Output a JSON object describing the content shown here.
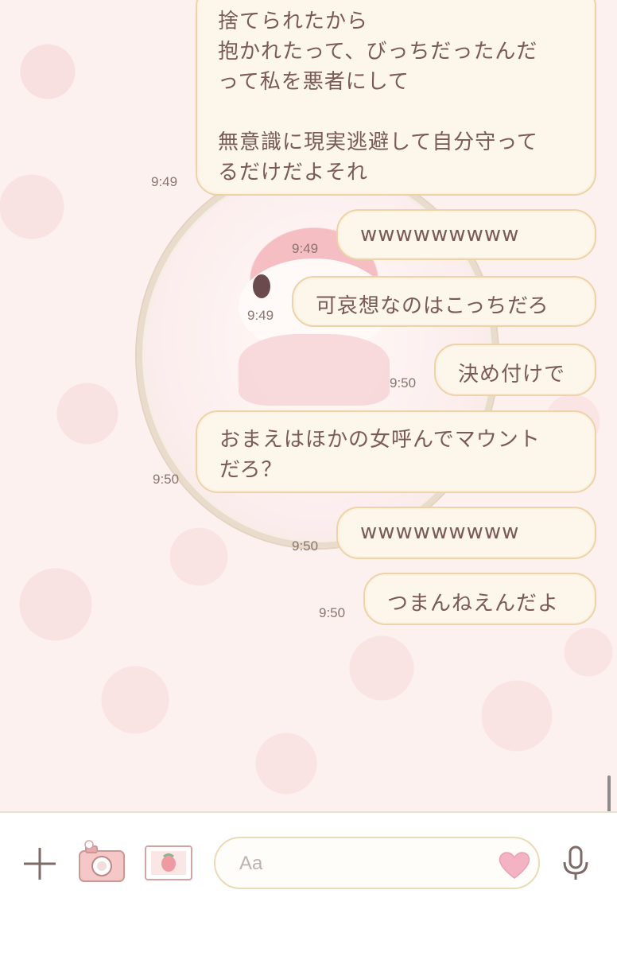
{
  "messages": [
    {
      "text": "捨てられたから\n抱かれたって、びっちだったんだ\nって私を悪者にして\n\n無意識に現実逃避して自分守って\nるだけだよそれ",
      "time": "9:49"
    },
    {
      "text": "wwwwwwwww",
      "time": "9:49"
    },
    {
      "text": "可哀想なのはこっちだろ",
      "time": "9:49"
    },
    {
      "text": "決め付けで",
      "time": "9:50"
    },
    {
      "text": "おまえはほかの女呼んでマウント\nだろ？",
      "time": "9:50"
    },
    {
      "text": "wwwwwwwww",
      "time": "9:50"
    },
    {
      "text": "つまんねえんだよ",
      "time": "9:50"
    }
  ],
  "input": {
    "placeholder": "Aa"
  },
  "icons": {
    "add": "plus-icon",
    "camera": "camera-icon",
    "gallery": "photo-icon",
    "emoji": "heart-icon",
    "mic": "microphone-icon"
  },
  "colors": {
    "bubble_fill": "#fdf6ea",
    "bubble_border": "#ecd3a8",
    "text": "#7a5a56",
    "background": "#fdf1ef"
  }
}
